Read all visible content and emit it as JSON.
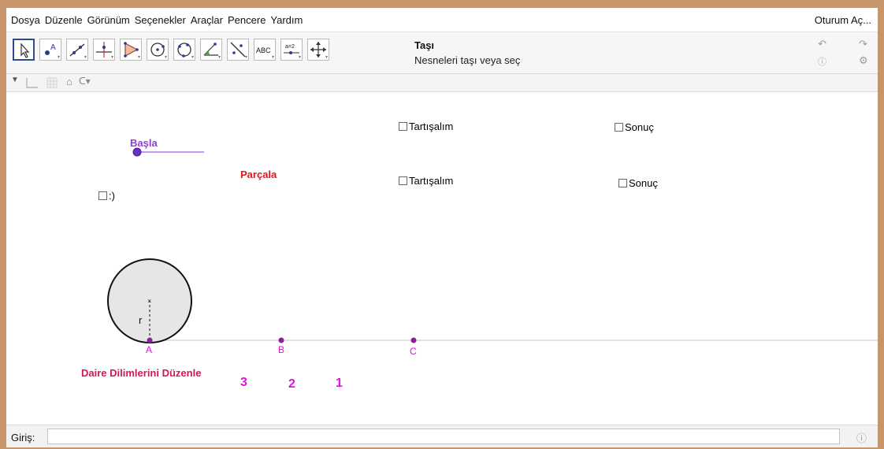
{
  "menu": {
    "items": [
      "Dosya",
      "Düzenle",
      "Görünüm",
      "Seçenekler",
      "Araçlar",
      "Pencere",
      "Yardım"
    ],
    "login": "Oturum Aç..."
  },
  "toolbar": {
    "tools": [
      {
        "name": "move-tool-icon",
        "selected": true
      },
      {
        "name": "point-tool-icon",
        "selected": false
      },
      {
        "name": "line-tool-icon",
        "selected": false
      },
      {
        "name": "perpendicular-tool-icon",
        "selected": false
      },
      {
        "name": "polygon-tool-icon",
        "selected": false
      },
      {
        "name": "circle-center-point-tool-icon",
        "selected": false
      },
      {
        "name": "circle-three-points-tool-icon",
        "selected": false
      },
      {
        "name": "angle-tool-icon",
        "selected": false
      },
      {
        "name": "reflect-tool-icon",
        "selected": false
      },
      {
        "name": "text-tool-icon",
        "selected": false,
        "label": "ABC"
      },
      {
        "name": "slider-tool-icon",
        "selected": false,
        "label": "a=2"
      },
      {
        "name": "move-graphics-view-tool-icon",
        "selected": false
      }
    ],
    "tool_title": "Taşı",
    "tool_desc": "Nesneleri taşı veya seç",
    "undo_icon": "undo-icon",
    "redo_icon": "redo-icon",
    "help_icon": "help-icon",
    "settings_icon": "gear-icon"
  },
  "stylebar": {
    "icons": [
      "toggle-stylebar-icon",
      "axes-icon",
      "grid-icon",
      "home-icon",
      "point-capture-icon"
    ]
  },
  "graphics": {
    "checkboxes": [
      {
        "label": "Tartışalım",
        "checked": false
      },
      {
        "label": "Sonuç",
        "checked": false
      },
      {
        "label": "Tartışalım",
        "checked": false
      },
      {
        "label": "Sonuç",
        "checked": false
      },
      {
        "label": ":)",
        "checked": false
      }
    ],
    "slider_label": "Başla",
    "slider_value": 0,
    "parcala_label": "Parçala",
    "points": [
      "A",
      "B",
      "C"
    ],
    "radius_label": "r",
    "daire_label": "Daire Dilimlerini Düzenle",
    "numbers": [
      "3",
      "2",
      "1"
    ]
  },
  "colors": {
    "purple": "#8b3fd9",
    "slider_line": "#c39af2",
    "red": "#e0141b",
    "magenta": "#e010d6",
    "crimson": "#d3174f",
    "point": "#8c1f9a"
  },
  "inputbar": {
    "label": "Giriş:",
    "value": "",
    "help_icon": "help-icon"
  }
}
